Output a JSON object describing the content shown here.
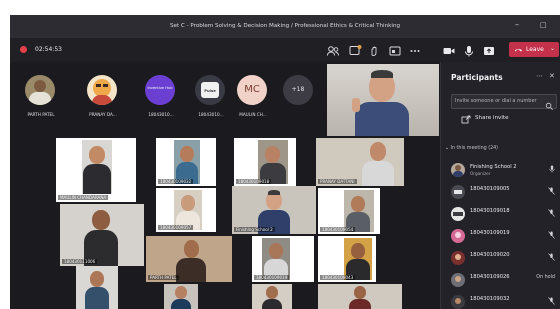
{
  "window": {
    "title": "Set C - Problem Solving & Decision Making / Professional Ethics & Critical Thinking"
  },
  "toolbar": {
    "timer": "02:54:53",
    "leave_label": "Leave"
  },
  "stage": [
    {
      "name": "PARTH PATEL",
      "type": "photo",
      "color": "#7c5a3f"
    },
    {
      "name": "PRANAY DA...",
      "type": "cartoon",
      "color": "#f0a94a"
    },
    {
      "name": "18043010...",
      "type": "logo",
      "color": "#6a3fd1",
      "logo_text": "Inventive Hub"
    },
    {
      "name": "18043010...",
      "type": "logo",
      "color": "#3a3a44",
      "logo_text": "Pulse"
    },
    {
      "name": "MAULIN CH...",
      "type": "initials",
      "color": "#f1d2c8",
      "initials": "MC"
    }
  ],
  "overflow_count": "+18",
  "grid": [
    {
      "label": "MAULIN CHANDARANA",
      "skin": "#c28b66",
      "shirt": "#2b2b30",
      "bg": "#d9d7d3"
    },
    {
      "label": "180430109032",
      "skin": "#b47c5a",
      "shirt": "#3b6c8f",
      "bg": "#8aa0a8"
    },
    {
      "label": "180430109018",
      "skin": "#b88163",
      "shirt": "#3b3b40",
      "bg": "#9e9688"
    },
    {
      "label": "PRANAY DATTANI",
      "skin": "#c0896a",
      "shirt": "#d8d8d8",
      "bg": "#cfc9be"
    },
    {
      "label": "180430109057",
      "skin": "#c89b7a",
      "shirt": "#ece6dc",
      "bg": "#d6cfc2"
    },
    {
      "label": "Finishing School 2",
      "skin": "#d3a184",
      "shirt": "#2f3f6a",
      "bg": "#c9c4bc"
    },
    {
      "label": "180430109054",
      "skin": "#b17a58",
      "shirt": "#5a5f67",
      "bg": "#bdb6aa"
    },
    {
      "label": "180430111006",
      "skin": "#8e5c40",
      "shirt": "#2c2c2f",
      "bg": "#d5d2cd"
    },
    {
      "label": "PARTH PATEL",
      "skin": "#a06c4c",
      "shirt": "#3c2d26",
      "bg": "#bfa58a"
    },
    {
      "label": "180430109019",
      "skin": "#a87658",
      "shirt": "#d7d7d8",
      "bg": "#8f8c86"
    },
    {
      "label": "180430109043",
      "skin": "#96603f",
      "shirt": "#2a2a2d",
      "bg": "#d4a246"
    },
    {
      "label": "",
      "skin": "#ad7757",
      "shirt": "#34506b",
      "bg": "#d9d8d5"
    },
    {
      "label": "",
      "skin": "#b68063",
      "shirt": "#1d3c5c",
      "bg": "#c7c2bb"
    },
    {
      "label": "",
      "skin": "#a26e50",
      "shirt": "#2a2a2f",
      "bg": "#d4cec4"
    },
    {
      "label": "",
      "skin": "#9b6446",
      "shirt": "#6b2a28",
      "bg": "#cfc9c0"
    }
  ],
  "panel": {
    "title": "Participants",
    "invite_placeholder": "Invite someone or dial a number",
    "share_label": "Share invite",
    "section_label": "In this meeting (24)",
    "participants": [
      {
        "name": "Finishing School 2",
        "role": "Organizer",
        "status": "",
        "color": "#b5a89a"
      },
      {
        "name": "180430109005",
        "role": "",
        "status": "",
        "color": "#4a4a52"
      },
      {
        "name": "180430109018",
        "role": "",
        "status": "",
        "color": "#e6e6e6"
      },
      {
        "name": "180430109019",
        "role": "",
        "status": "",
        "color": "#d66a96"
      },
      {
        "name": "180430109020",
        "role": "",
        "status": "",
        "color": "#7a2f2f"
      },
      {
        "name": "180430109026",
        "role": "",
        "status": "On hold",
        "color": "#6e6e77"
      },
      {
        "name": "180430109032",
        "role": "",
        "status": "",
        "color": "#3a3a40"
      }
    ]
  },
  "colors": {
    "leave": "#c4314b",
    "accent": "#6264a7",
    "recording": "#e4414a"
  }
}
